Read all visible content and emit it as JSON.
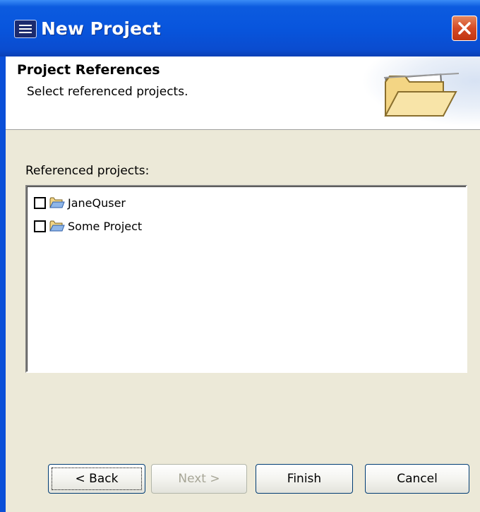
{
  "window": {
    "title": "New Project",
    "app_icon": "eclipse-icon",
    "close_icon": "close-x-icon"
  },
  "header": {
    "title": "Project References",
    "subtitle": "Select referenced projects.",
    "icon": "open-folder-icon"
  },
  "content": {
    "referenced_label": "Referenced projects:",
    "projects": [
      {
        "label": "JaneQuser",
        "checked": false,
        "icon": "folder-icon"
      },
      {
        "label": "Some Project",
        "checked": false,
        "icon": "folder-icon"
      }
    ]
  },
  "buttons": {
    "back": "< Back",
    "next": "Next >",
    "finish": "Finish",
    "cancel": "Cancel"
  },
  "colors": {
    "titlebar_blue": "#0855dd",
    "close_red": "#d54a25",
    "dialog_face": "#ece9d8",
    "disabled_text": "#a7a697"
  }
}
